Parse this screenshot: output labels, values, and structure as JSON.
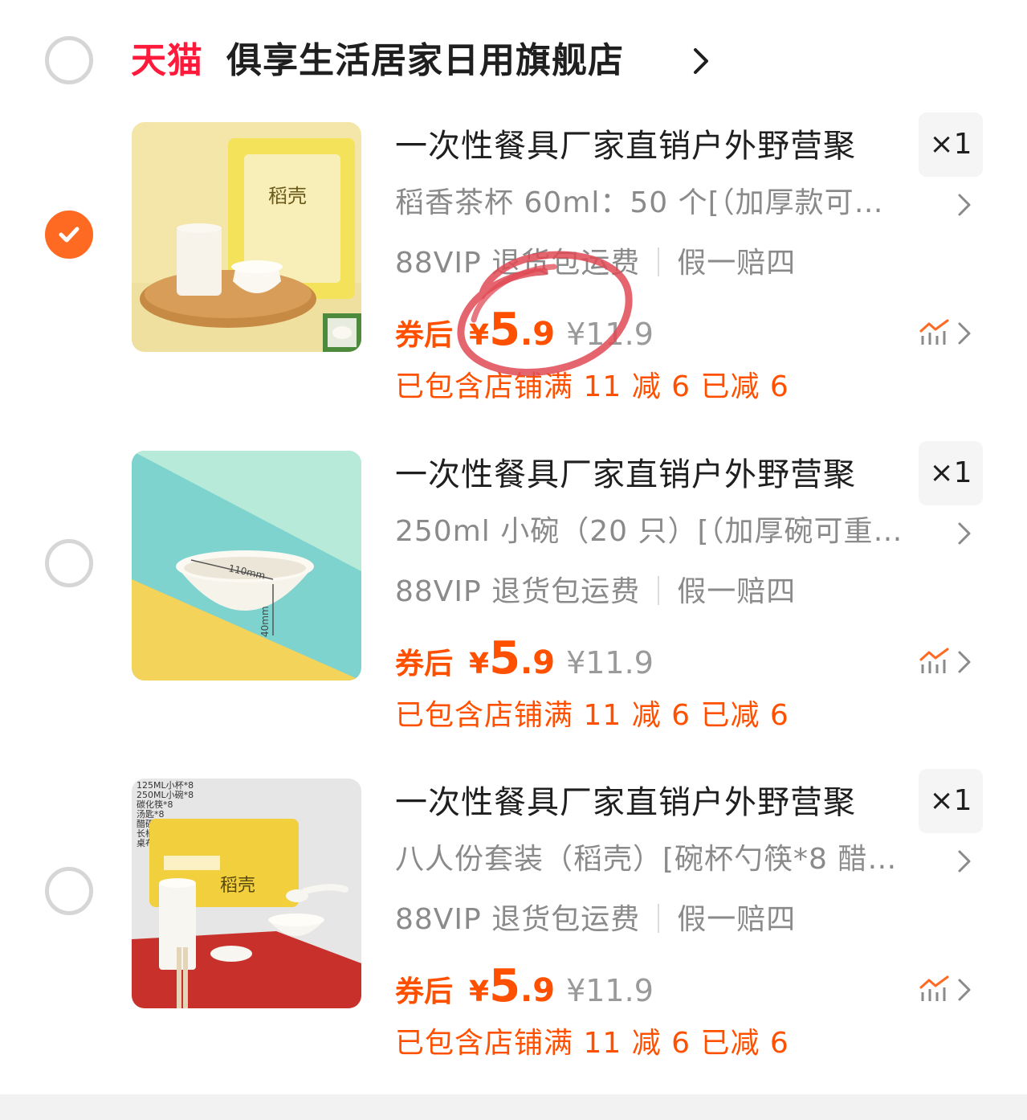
{
  "store": {
    "logo": "天猫",
    "name": "俱享生活居家日用旗舰店"
  },
  "items": [
    {
      "title": "一次性餐具厂家直销户外野营聚",
      "qty": "×1",
      "sku": "稻香茶杯 60ml：50 个[（加厚款可…",
      "tag1": "88VIP 退货包运费",
      "tag2": "假一赔四",
      "after_label": "券后",
      "currency": "¥",
      "price_int": "5",
      "price_dec": ".9",
      "original_price": "¥11.9",
      "discount": "已包含店铺满 11 减 6 已减 6",
      "selected": true,
      "image_text": "稻壳"
    },
    {
      "title": "一次性餐具厂家直销户外野营聚",
      "qty": "×1",
      "sku": "250ml 小碗（20 只）[（加厚碗可重…",
      "tag1": "88VIP 退货包运费",
      "tag2": "假一赔四",
      "after_label": "券后",
      "currency": "¥",
      "price_int": "5",
      "price_dec": ".9",
      "original_price": "¥11.9",
      "discount": "已包含店铺满 11 减 6 已减 6",
      "selected": false,
      "image_labels": [
        "110mm",
        "40mm"
      ]
    },
    {
      "title": "一次性餐具厂家直销户外野营聚",
      "qty": "×1",
      "sku": "八人份套装（稻壳）[碗杯勺筷*8 醋…",
      "tag1": "88VIP 退货包运费",
      "tag2": "假一赔四",
      "after_label": "券后",
      "currency": "¥",
      "price_int": "5",
      "price_dec": ".9",
      "original_price": "¥11.9",
      "discount": "已包含店铺满 11 减 6 已减 6",
      "selected": false,
      "image_list": [
        "125ML小杯*8",
        "250ML小碗*8",
        "碳化筷*8",
        "汤匙*8",
        "醋碟*2",
        "长柄勺*1",
        "桌布*1"
      ],
      "image_text": "稻壳"
    }
  ],
  "colors": {
    "accent": "#ff5000",
    "tmall": "#ff1a3b",
    "check": "#ff6a22",
    "annotation": "#e04a55"
  },
  "icons": [
    "check-icon",
    "chevron-right-icon",
    "price-trend-icon"
  ]
}
